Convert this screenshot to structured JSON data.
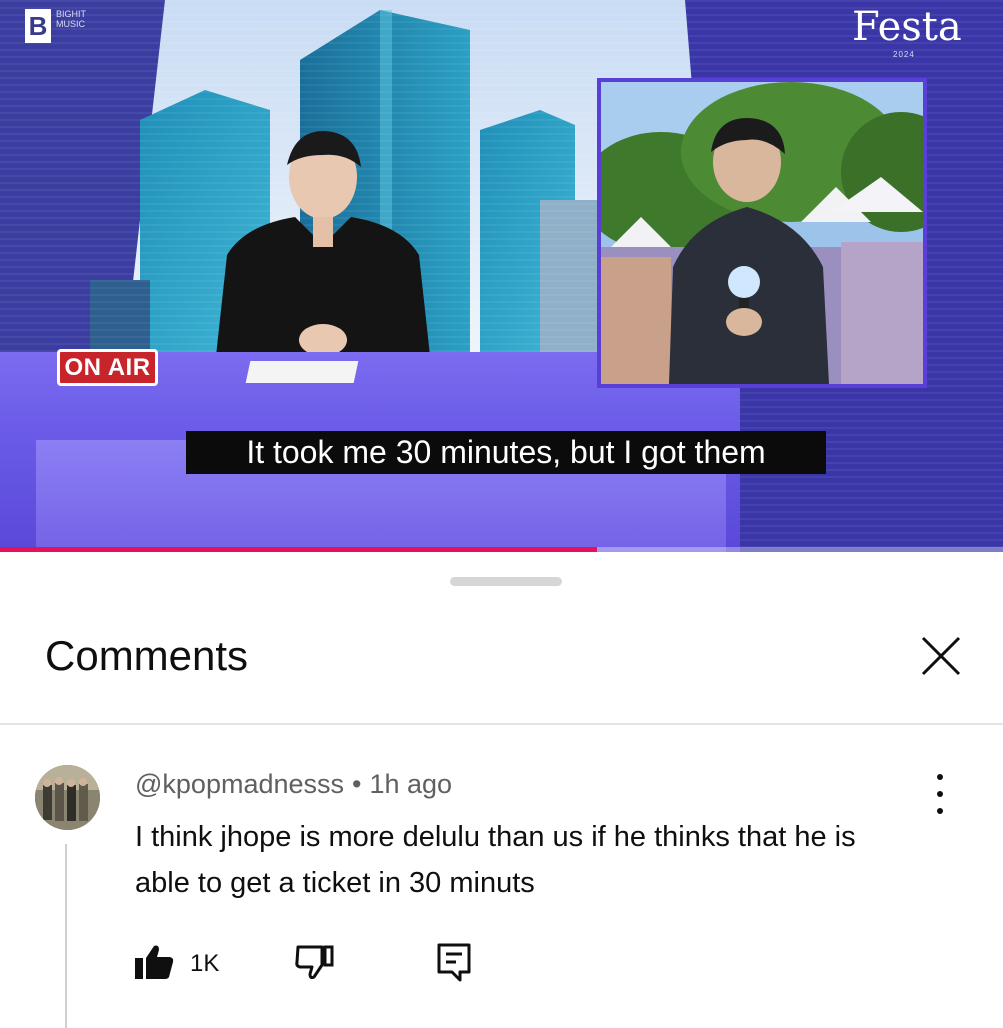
{
  "video": {
    "channel_logo": "B",
    "channel_logo_small": "BIGHIT MUSIC",
    "event_logo": "Festa",
    "event_logo_sub": "2024",
    "on_air_label": "ON AIR",
    "subtitle": "It took me 30 minutes, but I got them",
    "progress": 0.595,
    "colors": {
      "accent_progress": "#e8105a",
      "on_air_red": "#c8242b",
      "set_purple": "#6a5be8"
    }
  },
  "comments": {
    "title": "Comments",
    "close_icon": "close-icon",
    "items": [
      {
        "author": "@kpopmadnesss",
        "separator": "•",
        "time": "1h ago",
        "text": "I think jhope is more delulu than us if he thinks that he is able to get a ticket in 30 minuts",
        "likes": "1K"
      }
    ]
  }
}
